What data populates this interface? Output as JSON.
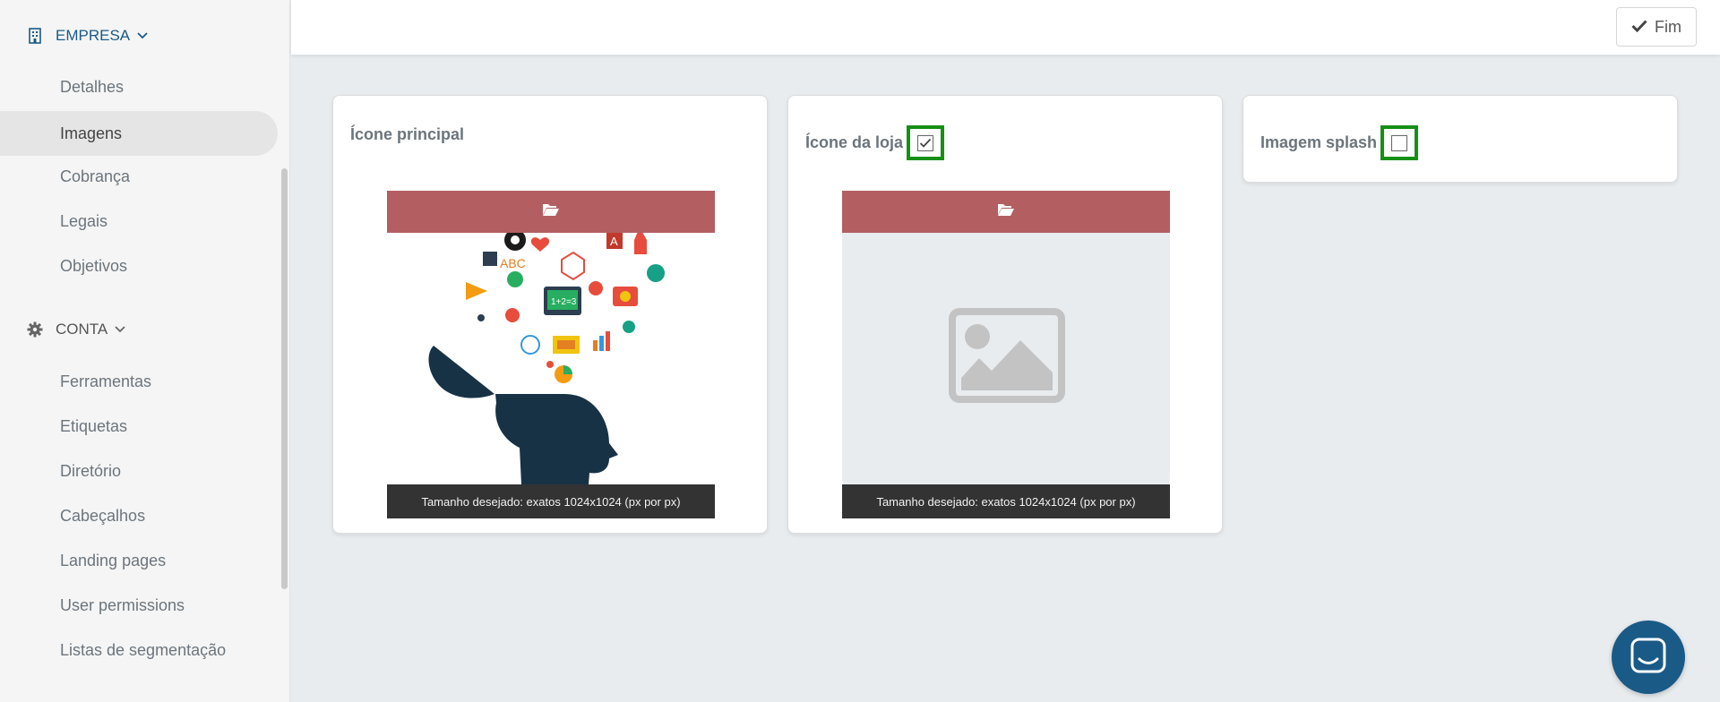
{
  "sidebar": {
    "empresa": {
      "label": "EMPRESA",
      "items": [
        "Detalhes",
        "Imagens",
        "Cobrança",
        "Legais",
        "Objetivos"
      ],
      "active": "Imagens"
    },
    "conta": {
      "label": "CONTA",
      "items": [
        "Ferramentas",
        "Etiquetas",
        "Diretório",
        "Cabeçalhos",
        "Landing pages",
        "User permissions",
        "Listas de segmentação"
      ]
    }
  },
  "topbar": {
    "finish_label": "Fim"
  },
  "cards": [
    {
      "title": "Ícone principal",
      "caption": "Tamanho desejado: exatos 1024x1024 (px por px)"
    },
    {
      "title": "Ícone da loja",
      "checked": true,
      "caption": "Tamanho desejado: exatos 1024x1024 (px por px)"
    },
    {
      "title": "Imagem splash",
      "checked": false
    }
  ],
  "icons": {
    "empresa": "building-icon",
    "conta": "gear-icon",
    "chevron": "chevron-down-icon",
    "finish": "check-icon",
    "upload": "folder-open-icon",
    "placeholder": "image-placeholder-icon",
    "chat": "chat-icon"
  },
  "colors": {
    "accent": "#1a5a87",
    "upload_bar": "#b35f62",
    "caption_bg": "#333333",
    "highlight_green": "#159015"
  }
}
